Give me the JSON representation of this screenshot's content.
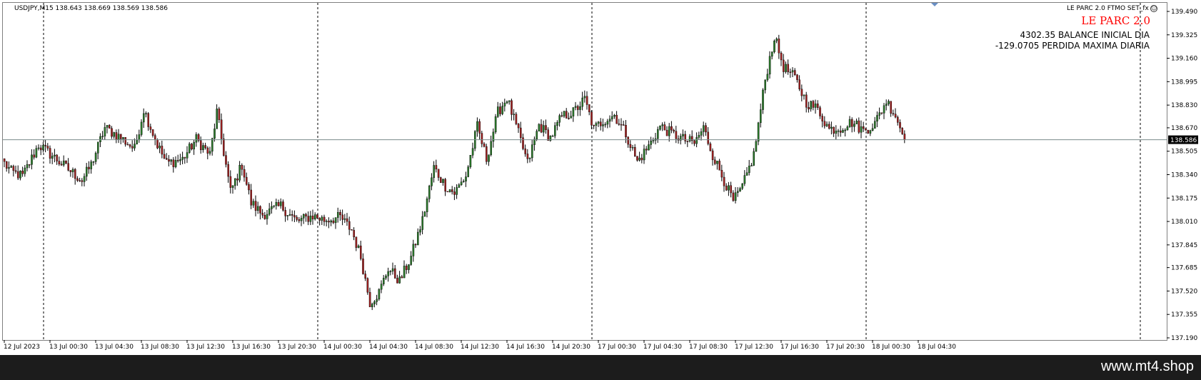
{
  "symbol_info": "USDJPY,M15  138.643 138.669 138.569 138.586",
  "ea": {
    "label": "LE PARC 2.0 FTMO SET_fx",
    "face": "☺"
  },
  "indicator": {
    "title": "LE PARC 2.0",
    "balance_line": "4302.35 BALANCE INICIAL DIA",
    "loss_line": "-129.0705 PERDIDA MAXIMA DIARIA"
  },
  "footer": {
    "watermark": "www.mt4.shop"
  },
  "colors": {
    "bull_body": "#2a7a2a",
    "bear_body": "#a02020",
    "wick": "#000000",
    "price_line": "#7a8a8a",
    "price_label_bg": "#000000",
    "price_label_fg": "#ffffff"
  },
  "chart_data": {
    "type": "candlestick",
    "symbol": "USDJPY",
    "timeframe": "M15",
    "current_price": 138.586,
    "current_price_label": "138.586",
    "ylim": [
      137.19,
      139.5
    ],
    "y_ticks": [
      "139.490",
      "139.325",
      "139.160",
      "138.995",
      "138.830",
      "138.670",
      "138.505",
      "138.340",
      "138.175",
      "138.010",
      "137.845",
      "137.685",
      "137.520",
      "137.355",
      "137.190"
    ],
    "x_ticks": [
      "12 Jul 2023",
      "13 Jul 00:30",
      "13 Jul 04:30",
      "13 Jul 08:30",
      "13 Jul 12:30",
      "13 Jul 16:30",
      "13 Jul 20:30",
      "14 Jul 00:30",
      "14 Jul 04:30",
      "14 Jul 08:30",
      "14 Jul 12:30",
      "14 Jul 16:30",
      "14 Jul 20:30",
      "17 Jul 00:30",
      "17 Jul 04:30",
      "17 Jul 08:30",
      "17 Jul 12:30",
      "17 Jul 16:30",
      "17 Jul 20:30",
      "18 Jul 00:30",
      "18 Jul 04:30"
    ],
    "period_separators": [
      "13 Jul",
      "14 Jul",
      "14 Jul 20:30",
      "17 Jul 16:30",
      "18 Jul",
      "future"
    ],
    "anchors": [
      [
        0,
        138.42
      ],
      [
        3,
        138.36
      ],
      [
        8,
        138.33
      ],
      [
        15,
        138.55
      ],
      [
        22,
        138.46
      ],
      [
        27,
        138.39
      ],
      [
        34,
        138.3
      ],
      [
        38,
        138.41
      ],
      [
        44,
        138.67
      ],
      [
        51,
        138.6
      ],
      [
        57,
        138.52
      ],
      [
        61,
        138.8
      ],
      [
        67,
        138.55
      ],
      [
        71,
        138.42
      ],
      [
        78,
        138.45
      ],
      [
        84,
        138.59
      ],
      [
        90,
        138.48
      ],
      [
        93,
        138.78
      ],
      [
        99,
        138.22
      ],
      [
        104,
        138.41
      ],
      [
        108,
        138.14
      ],
      [
        113,
        138.06
      ],
      [
        121,
        138.12
      ],
      [
        128,
        138.01
      ],
      [
        135,
        138.05
      ],
      [
        140,
        138.02
      ],
      [
        147,
        138.04
      ],
      [
        152,
        137.95
      ],
      [
        156,
        137.76
      ],
      [
        160,
        137.44
      ],
      [
        164,
        137.51
      ],
      [
        168,
        137.68
      ],
      [
        173,
        137.59
      ],
      [
        178,
        137.76
      ],
      [
        183,
        138.02
      ],
      [
        188,
        138.39
      ],
      [
        193,
        138.26
      ],
      [
        197,
        138.21
      ],
      [
        202,
        138.33
      ],
      [
        207,
        138.68
      ],
      [
        211,
        138.45
      ],
      [
        216,
        138.78
      ],
      [
        220,
        138.88
      ],
      [
        225,
        138.63
      ],
      [
        229,
        138.42
      ],
      [
        234,
        138.69
      ],
      [
        239,
        138.6
      ],
      [
        244,
        138.75
      ],
      [
        249,
        138.78
      ],
      [
        254,
        138.87
      ],
      [
        258,
        138.66
      ],
      [
        262,
        138.72
      ],
      [
        267,
        138.76
      ],
      [
        272,
        138.63
      ],
      [
        277,
        138.43
      ],
      [
        282,
        138.54
      ],
      [
        287,
        138.68
      ],
      [
        292,
        138.63
      ],
      [
        297,
        138.59
      ],
      [
        302,
        138.56
      ],
      [
        306,
        138.67
      ],
      [
        310,
        138.48
      ],
      [
        315,
        138.3
      ],
      [
        319,
        138.15
      ],
      [
        323,
        138.25
      ],
      [
        328,
        138.48
      ],
      [
        333,
        139.01
      ],
      [
        337,
        139.31
      ],
      [
        341,
        139.1
      ],
      [
        346,
        139.02
      ],
      [
        351,
        138.85
      ],
      [
        356,
        138.8
      ],
      [
        361,
        138.66
      ],
      [
        366,
        138.67
      ],
      [
        371,
        138.71
      ],
      [
        376,
        138.65
      ],
      [
        381,
        138.7
      ],
      [
        386,
        138.86
      ],
      [
        390,
        138.76
      ],
      [
        394,
        138.59
      ]
    ],
    "candle_count": 395
  }
}
